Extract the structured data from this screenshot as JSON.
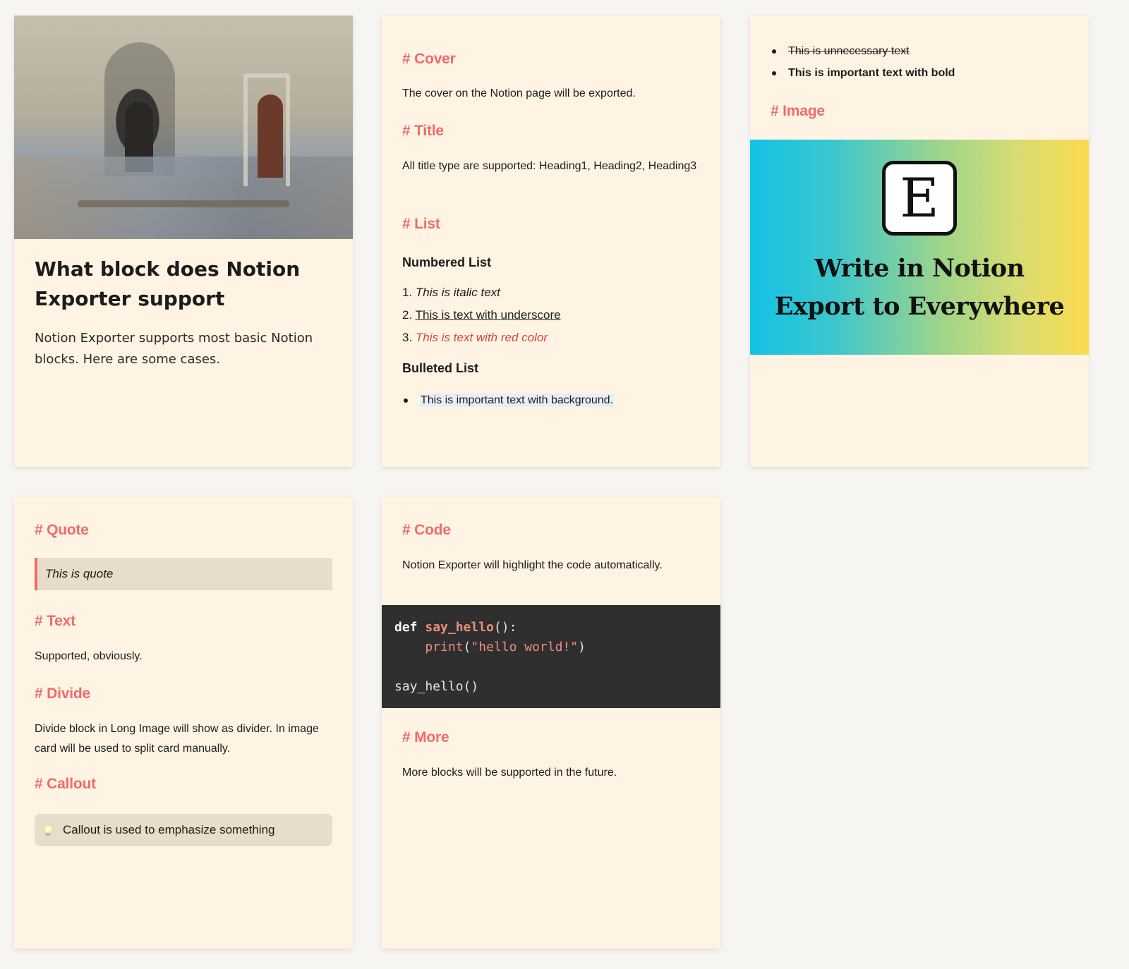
{
  "card1": {
    "title": "What block does Notion Exporter support",
    "description": "Notion Exporter supports most basic Notion blocks. Here are some cases."
  },
  "card2": {
    "cover_heading": "# Cover",
    "cover_text": "The cover on the Notion page will be exported.",
    "title_heading": "# Title",
    "title_text": "All title type are supported: Heading1, Heading2, Heading3",
    "list_heading": "# List",
    "numbered_list_title": "Numbered List",
    "numbered_items": [
      {
        "num": "1.",
        "text": "This is italic text"
      },
      {
        "num": "2.",
        "text": "This is text with underscore"
      },
      {
        "num": "3.",
        "text": "This is text with red color"
      }
    ],
    "bulleted_list_title": "Bulleted List",
    "bulleted_items": [
      "This is important text with background."
    ]
  },
  "card3": {
    "bullets": [
      "This is unnecessary text",
      "This is important text with bold"
    ],
    "image_heading": "# Image",
    "banner": {
      "logo_letter": "E",
      "line1": "Write in Notion",
      "line2": "Export to Everywhere"
    }
  },
  "card4": {
    "quote_heading": "# Quote",
    "quote_text": "This is quote",
    "text_heading": "# Text",
    "text_body": "Supported, obviously.",
    "divide_heading": "# Divide",
    "divide_body": "Divide block in Long Image will show as divider. In image card will be used to split card manually.",
    "callout_heading": "# Callout",
    "callout_icon": "lightbulb-icon",
    "callout_text": "Callout is used to emphasize something"
  },
  "card5": {
    "code_heading": "# Code",
    "code_text": "Notion Exporter will highlight the code automatically.",
    "code": {
      "kw_def": "def",
      "fn_name": "say_hello",
      "sig_rest": "():",
      "indent": "    ",
      "print_fn": "print",
      "open_paren": "(",
      "string": "\"hello world!\"",
      "close_paren": ")",
      "call": "say_hello()"
    },
    "more_heading": "# More",
    "more_text": "More blocks will be supported in the future."
  },
  "colors": {
    "page_bg": "#f7f5f1",
    "card_bg": "#fff4e3",
    "heading_accent": "#ef6b6b",
    "red_text": "#d9413e",
    "code_bg": "#2f2f2f",
    "quote_bg": "#e8dcca"
  }
}
